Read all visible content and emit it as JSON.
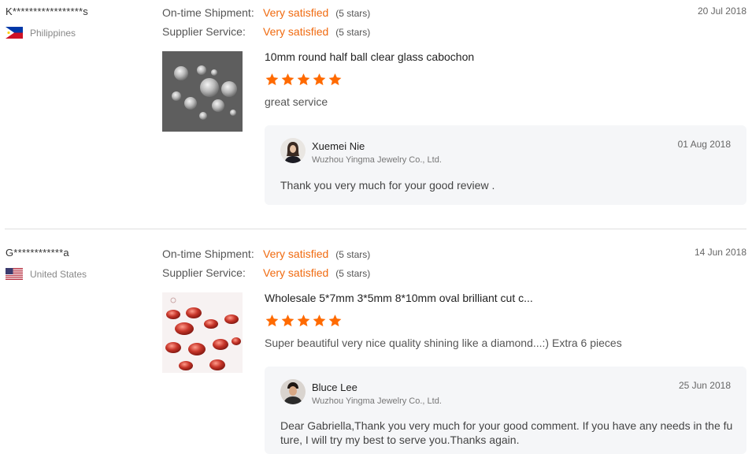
{
  "reviews": [
    {
      "buyer": "K*****************s",
      "country": "Philippines",
      "date": "20 Jul 2018",
      "ratings": [
        {
          "label": "On-time Shipment:",
          "value": "Very satisfied",
          "stars": "(5 stars)"
        },
        {
          "label": "Supplier Service:",
          "value": "Very satisfied",
          "stars": "(5 stars)"
        }
      ],
      "product": "10mm round half ball clear glass cabochon",
      "star_count": 5,
      "comment": "great service",
      "reply": {
        "name": "Xuemei Nie",
        "company": "Wuzhou Yingma Jewelry Co., Ltd.",
        "date": "01 Aug 2018",
        "text": "Thank you very much for your good review ."
      }
    },
    {
      "buyer": "G************a",
      "country": "United States",
      "date": "14 Jun 2018",
      "ratings": [
        {
          "label": "On-time Shipment:",
          "value": "Very satisfied",
          "stars": "(5 stars)"
        },
        {
          "label": "Supplier Service:",
          "value": "Very satisfied",
          "stars": "(5 stars)"
        }
      ],
      "product": "Wholesale 5*7mm 3*5mm 8*10mm oval brilliant cut c...",
      "star_count": 5,
      "comment": "Super beautiful very nice quality shining like a diamond...:) Extra 6 pieces",
      "reply": {
        "name": "Bluce Lee",
        "company": "Wuzhou Yingma Jewelry Co., Ltd.",
        "date": "25 Jun 2018",
        "text_line1": "Dear Gabriella,Thank you very much for your good comment. If you have any needs in the fu",
        "text_line2": "ture, I will try my best to serve you.Thanks again."
      }
    }
  ],
  "colors": {
    "accent": "#f06a0f",
    "star": "#ff6a00",
    "reply_bg": "#f5f6f8",
    "divider": "#e0e0e0"
  },
  "icons": {
    "flag_1": "philippines-flag-icon",
    "flag_2": "united-states-flag-icon",
    "star": "star-icon"
  }
}
